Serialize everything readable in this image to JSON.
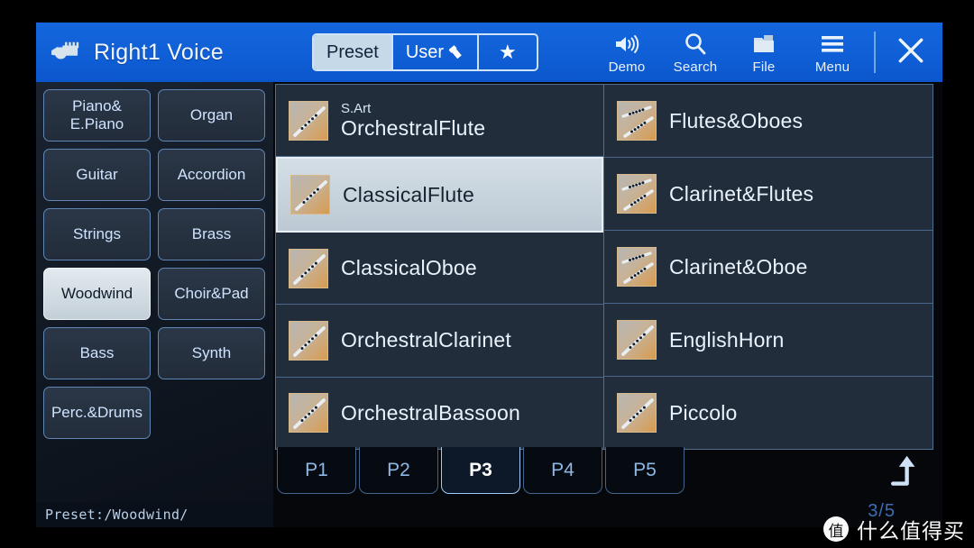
{
  "header": {
    "voice_icon": "hand-keyboard-icon",
    "title": "Right1 Voice",
    "segments": [
      {
        "label": "Preset",
        "icon": null,
        "active": true
      },
      {
        "label": "User",
        "icon": "usb-stick-icon",
        "active": false
      },
      {
        "label": "★",
        "icon": "star-icon",
        "active": false
      }
    ],
    "tools": [
      {
        "label": "Demo",
        "icon": "speaker-icon"
      },
      {
        "label": "Search",
        "icon": "search-icon"
      },
      {
        "label": "File",
        "icon": "folder-icon"
      },
      {
        "label": "Menu",
        "icon": "hamburger-menu-icon"
      }
    ],
    "close_label": "✕",
    "close_icon": "close-icon",
    "accent_color": "#0f5ed6"
  },
  "sidebar": {
    "categories": [
      {
        "label": "Piano&\nE.Piano",
        "selected": false
      },
      {
        "label": "Organ",
        "selected": false
      },
      {
        "label": "Guitar",
        "selected": false
      },
      {
        "label": "Accordion",
        "selected": false
      },
      {
        "label": "Strings",
        "selected": false
      },
      {
        "label": "Brass",
        "selected": false
      },
      {
        "label": "Woodwind",
        "selected": true
      },
      {
        "label": "Choir&Pad",
        "selected": false
      },
      {
        "label": "Bass",
        "selected": false
      },
      {
        "label": "Synth",
        "selected": false
      },
      {
        "label": "Perc.&Drums",
        "selected": false
      }
    ],
    "selected_color": "#c3cfd8"
  },
  "path_bar": {
    "text": "Preset:/Woodwind/"
  },
  "voice_list": {
    "left_column": [
      {
        "tag": "S.Art",
        "name": "OrchestralFlute",
        "icon": "flute-thumbnail",
        "selected": false,
        "combo": false
      },
      {
        "tag": "",
        "name": "ClassicalFlute",
        "icon": "flute-thumbnail",
        "selected": true,
        "combo": false
      },
      {
        "tag": "",
        "name": "ClassicalOboe",
        "icon": "oboe-thumbnail",
        "selected": false,
        "combo": false
      },
      {
        "tag": "",
        "name": "OrchestralClarinet",
        "icon": "clarinet-thumbnail",
        "selected": false,
        "combo": false
      },
      {
        "tag": "",
        "name": "OrchestralBassoon",
        "icon": "bassoon-thumbnail",
        "selected": false,
        "combo": false
      }
    ],
    "right_column": [
      {
        "tag": "",
        "name": "Flutes&Oboes",
        "icon": "flutes-oboes-thumbnail",
        "selected": false,
        "combo": true
      },
      {
        "tag": "",
        "name": "Clarinet&Flutes",
        "icon": "clarinet-flutes-thumbnail",
        "selected": false,
        "combo": true
      },
      {
        "tag": "",
        "name": "Clarinet&Oboe",
        "icon": "clarinet-oboe-thumbnail",
        "selected": false,
        "combo": true
      },
      {
        "tag": "",
        "name": "EnglishHorn",
        "icon": "english-horn-thumbnail",
        "selected": false,
        "combo": false
      },
      {
        "tag": "",
        "name": "Piccolo",
        "icon": "piccolo-thumbnail",
        "selected": false,
        "combo": false
      }
    ],
    "selected_row_color": "#c3ced6"
  },
  "page_tabs": {
    "tabs": [
      {
        "label": "P1",
        "active": false
      },
      {
        "label": "P2",
        "active": false
      },
      {
        "label": "P3",
        "active": true
      },
      {
        "label": "P4",
        "active": false
      },
      {
        "label": "P5",
        "active": false
      }
    ],
    "page_indicator": "3/5",
    "up_icon": "up-arrow-icon"
  },
  "watermark": {
    "logo_char": "值",
    "text": "什么值得买"
  }
}
